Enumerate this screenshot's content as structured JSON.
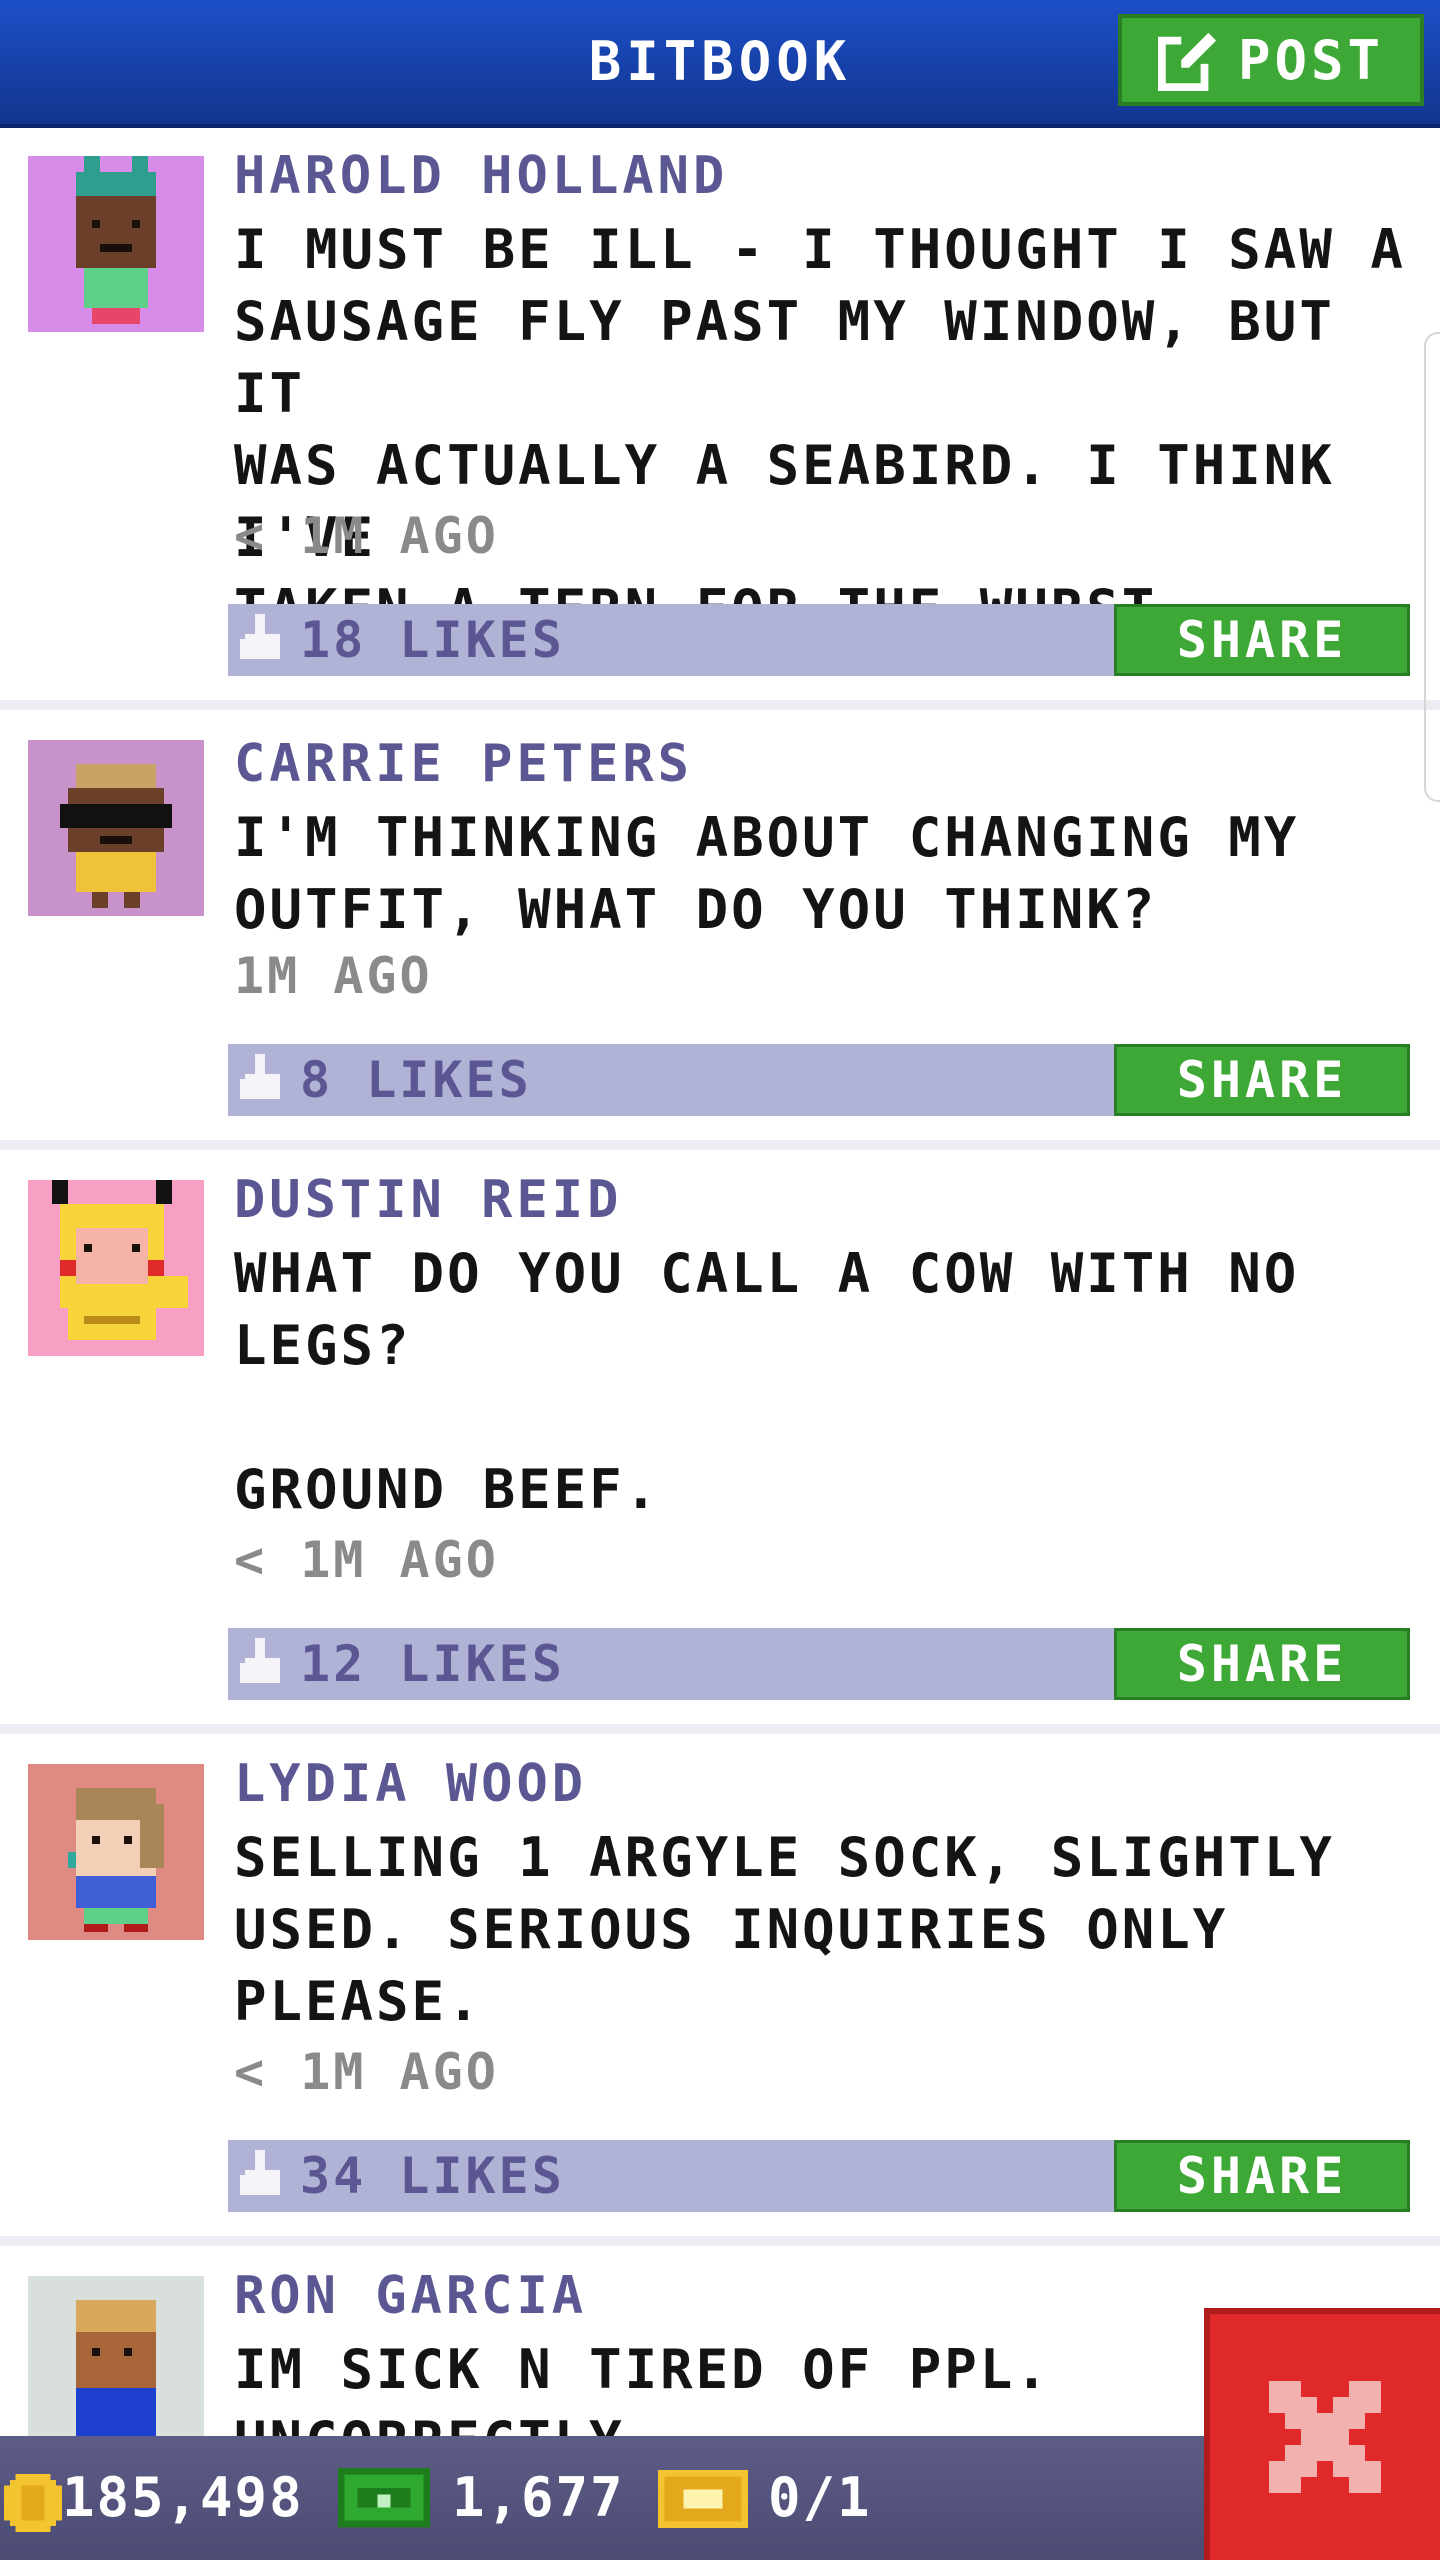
{
  "header": {
    "title": "BITBOOK",
    "post_label": "POST"
  },
  "posts": [
    {
      "name": "HAROLD HOLLAND",
      "message": "I MUST BE ILL - I THOUGHT I SAW A\nSAUSAGE FLY PAST MY WINDOW, BUT IT\nWAS ACTUALLY A SEABIRD. I THINK I'VE\nTAKEN A TERN FOR THE WURST.",
      "time": "< 1M AGO",
      "likes": "18 LIKES",
      "share_label": "SHARE",
      "avatar_bg": "#d68ce8"
    },
    {
      "name": "CARRIE PETERS",
      "message": "I'M THINKING ABOUT CHANGING MY\nOUTFIT, WHAT DO YOU THINK?",
      "time": "1M AGO",
      "likes": "8 LIKES",
      "share_label": "SHARE",
      "avatar_bg": "#c892cc"
    },
    {
      "name": "DUSTIN REID",
      "message": "WHAT DO YOU CALL A COW WITH NO\nLEGS?\n\nGROUND BEEF.",
      "time": "< 1M AGO",
      "likes": "12 LIKES",
      "share_label": "SHARE",
      "avatar_bg": "#f7a0c4"
    },
    {
      "name": "LYDIA WOOD",
      "message": "SELLING 1 ARGYLE SOCK, SLIGHTLY\nUSED. SERIOUS INQUIRIES ONLY\nPLEASE.",
      "time": "< 1M AGO",
      "likes": "34 LIKES",
      "share_label": "SHARE",
      "avatar_bg": "#e08a84"
    },
    {
      "name": "RON GARCIA",
      "message": "IM SICK N TIRED OF PPL. UNCORRECTLY\nUSING PUNCTUATION",
      "avatar_bg": "#d9e0dc"
    }
  ],
  "bottom": {
    "coins": "185,498",
    "bux": "1,677",
    "tickets": "0/1"
  },
  "colors": {
    "header_blue": "#1c4fc8",
    "button_green": "#3ea836",
    "like_bar": "#b1b3d6",
    "name_purple": "#5b5793",
    "close_red": "#e02a2a"
  },
  "icons": [
    "edit-icon",
    "like-thumb-icon",
    "coin-icon",
    "bux-icon",
    "ticket-icon",
    "close-icon"
  ]
}
